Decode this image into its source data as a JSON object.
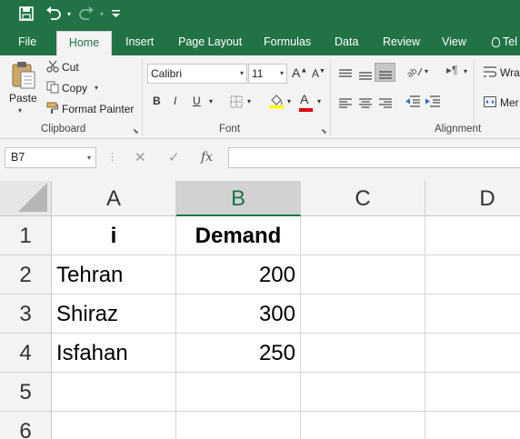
{
  "qat": {
    "save_icon": "save-icon",
    "undo_icon": "undo-icon",
    "redo_icon": "redo-icon",
    "customize_icon": "customize-qat-icon"
  },
  "tabs": [
    {
      "label": "File"
    },
    {
      "label": "Home"
    },
    {
      "label": "Insert"
    },
    {
      "label": "Page Layout"
    },
    {
      "label": "Formulas"
    },
    {
      "label": "Data"
    },
    {
      "label": "Review"
    },
    {
      "label": "View"
    },
    {
      "label": "Tel"
    }
  ],
  "ribbon": {
    "clipboard": {
      "paste": "Paste",
      "cut": "Cut",
      "copy": "Copy",
      "format_painter": "Format Painter",
      "group": "Clipboard"
    },
    "font": {
      "name": "Calibri",
      "size": "11",
      "bold": "B",
      "italic": "I",
      "underline": "U",
      "grow": "A",
      "shrink": "A",
      "font_color": "A",
      "group": "Font"
    },
    "alignment": {
      "wrap": "Wra",
      "merge": "Mer",
      "group": "Alignment"
    }
  },
  "formula_bar": {
    "name_box": "B7",
    "cancel": "✕",
    "enter": "✓",
    "fx": "fx",
    "value": ""
  },
  "columns": [
    "A",
    "B",
    "C",
    "D"
  ],
  "selected_column": "B",
  "rows": [
    {
      "num": "1",
      "a": "i",
      "b": "Demand"
    },
    {
      "num": "2",
      "a": "Tehran",
      "b": "200"
    },
    {
      "num": "3",
      "a": "Shiraz",
      "b": "300"
    },
    {
      "num": "4",
      "a": "Isfahan",
      "b": "250"
    },
    {
      "num": "5",
      "a": "",
      "b": ""
    },
    {
      "num": "6",
      "a": "",
      "b": ""
    }
  ],
  "colors": {
    "excel_green": "#217346",
    "ribbon_bg": "#f3f3f3"
  }
}
